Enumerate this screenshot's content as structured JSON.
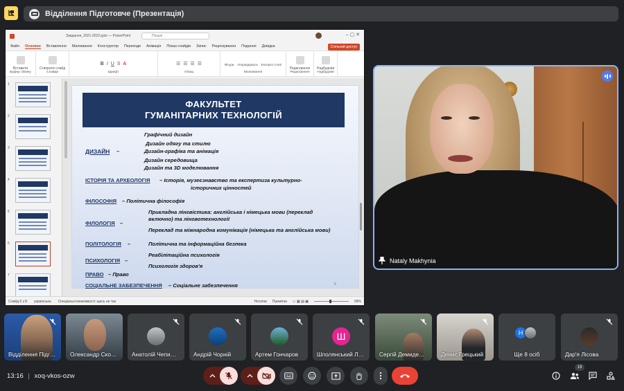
{
  "presentation": {
    "chip_title": "Відділення Підготовче (Презентація)"
  },
  "powerpoint": {
    "file_title": "Завдання_2021-2022.pptx — PowerPoint",
    "search_placeholder": "Пошук",
    "tabs": [
      "Файл",
      "Основне",
      "Вставлення",
      "Малювання",
      "Конструктор",
      "Переходи",
      "Анімація",
      "Показ слайдів",
      "Запис",
      "Рецензування",
      "Подання",
      "Довідка"
    ],
    "active_tab": "Основне",
    "share_label": "Спільний доступ",
    "ribbon_groups": [
      "Буфер обміну",
      "Слайди",
      "Шрифт",
      "Абзац",
      "Малювання",
      "Редагування",
      "Надбудови"
    ],
    "ribbon_buttons": {
      "paste": "Вставити",
      "new_slide": "Створити слайд",
      "arrange": "Фігури",
      "quick_styles": "Упорядкувати",
      "styles": "Експрес-стилі",
      "editing": "Редагування",
      "addins": "Надбудови"
    },
    "thumbnail_numbers": [
      "1",
      "2",
      "3",
      "4",
      "5",
      "6",
      "7"
    ],
    "selected_slide": "6",
    "status": {
      "slide": "Слайд 6 з 8",
      "language": "українська",
      "accessibility": "Спеціальні можливості: щось не так",
      "notes": "Нотатки",
      "comments": "Примітки",
      "zoom": "99%"
    }
  },
  "slide": {
    "title_line1": "ФАКУЛЬТЕТ",
    "title_line2": "ГУМАНІТАРНИХ ТЕХНОЛОГІЙ",
    "design_label": "ДИЗАЙН",
    "design_dash": "–",
    "design_items": [
      "Графічний дизайн",
      "Дизайн одягу та стилю",
      "Дизайн-графіка та анімація",
      "Дизайн середовища",
      "Дизайн та 3D моделювання"
    ],
    "history_label": "ІСТОРІЯ ТА АРХЕОЛОГІЯ",
    "history_text_1": "– Історія, музеєзнавство та експертиза культурно-",
    "history_text_2": "історичних цінностей",
    "philosophy_label": "ФІЛОСОФІЯ",
    "philosophy_text": "– Політична філософія",
    "philology_label": "ФІЛОЛОГІЯ",
    "philology_dash": "–",
    "philology_item1_l1": "Прикладна лінгвістика: англійська і німецька мови (переклад",
    "philology_item1_l2": "включно) та лінгвотехнології",
    "philology_item2": "Переклад та міжнародна комунікація (німецька та англійська мови)",
    "politology_label": "ПОЛІТОЛОГІЯ",
    "politology_dash": "–",
    "politology_text": "Політична та інформаційна безпека",
    "psychology_label": "ПСИХОЛОГІЯ",
    "psychology_dash": "–",
    "psychology_items": [
      "Реабілітаційна психологія",
      "Психологія здоров'я"
    ],
    "law_label": "ПРАВО",
    "law_text": "– Право",
    "social_label": "СОЦІАЛЬНЕ ЗАБЕЗПЕЧЕННЯ",
    "social_text": "– Соціальне забезпечення",
    "page_number": "6"
  },
  "speaker": {
    "name": "Nataly Makhynia"
  },
  "participants": [
    {
      "name": "Відділення Підг…",
      "kind": "video"
    },
    {
      "name": "Олександр Ско…",
      "kind": "video"
    },
    {
      "name": "Анатолій Чепи…",
      "kind": "avatar"
    },
    {
      "name": "Андрій Чорній",
      "kind": "avatar"
    },
    {
      "name": "Артем Гончаров",
      "kind": "avatar"
    },
    {
      "name": "Шполянський Л…",
      "kind": "letter",
      "letter": "Ш"
    },
    {
      "name": "Сергій Демиде…",
      "kind": "video"
    },
    {
      "name": "Денис Грецький",
      "kind": "video"
    },
    {
      "name": "Ще 8 осіб",
      "kind": "more",
      "letter": "Н"
    },
    {
      "name": "Дар'я Лісова",
      "kind": "avatar"
    }
  ],
  "meeting": {
    "time": "13:16",
    "separator": "|",
    "code": "xoq-vkos-ozw",
    "people_count": "19"
  },
  "colors": {
    "accent_blue": "#8ab4f8",
    "end_call_red": "#ea4335",
    "muted_pink": "#f9dedc",
    "slide_banner": "#1f3864",
    "ppt_accent": "#c43e1c"
  },
  "icons": [
    "warning-icon",
    "meet-logo-icon",
    "speaking-indicator-icon",
    "pin-icon",
    "mic-off-icon",
    "camera-off-icon",
    "chevron-up-icon",
    "captions-icon",
    "emoji-icon",
    "present-icon",
    "raise-hand-icon",
    "more-options-icon",
    "end-call-icon",
    "info-icon",
    "people-icon",
    "chat-icon",
    "activities-icon"
  ]
}
